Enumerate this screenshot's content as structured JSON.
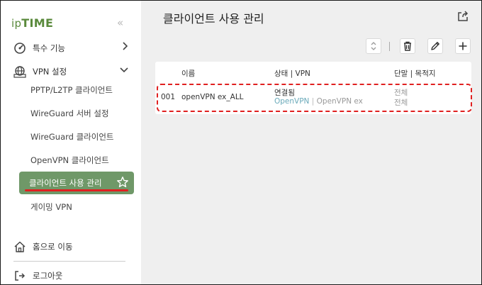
{
  "brand": {
    "logo_prefix": "ip",
    "logo_main": "TIME",
    "collapse_glyph": "«"
  },
  "sidebar": {
    "special": {
      "label": "특수 기능",
      "icon": "wrench-gauge-icon"
    },
    "vpn": {
      "label": "VPN 설정",
      "icon": "globe-network-icon"
    },
    "sub_items": [
      {
        "label": "PPTP/L2TP 클라이언트"
      },
      {
        "label": "WireGuard 서버 설정"
      },
      {
        "label": "WireGuard 클라이언트"
      },
      {
        "label": "OpenVPN 클라이언트"
      },
      {
        "label": "클라이언트 사용 관리"
      },
      {
        "label": "게이밍 VPN"
      }
    ],
    "home": {
      "label": "홈으로 이동",
      "icon": "home-icon"
    },
    "logout": {
      "label": "로그아웃",
      "icon": "logout-icon"
    }
  },
  "main": {
    "title": "클라이언트 사용 관리",
    "columns": [
      "이름",
      "상태 | VPN",
      "단말 | 목적지"
    ],
    "rows": [
      {
        "id": "001",
        "name": "openVPN ex_ALL",
        "status": "연결됨",
        "vpn_name": "OpenVPN",
        "vpn_sep": " | ",
        "vpn_type": "OpenVPN ex",
        "device": "전체",
        "destination": "전체"
      }
    ]
  },
  "colors": {
    "accent": "#6f9868",
    "logo": "#5a8a3c",
    "highlight": "#e02020",
    "link": "#6aaaba"
  }
}
